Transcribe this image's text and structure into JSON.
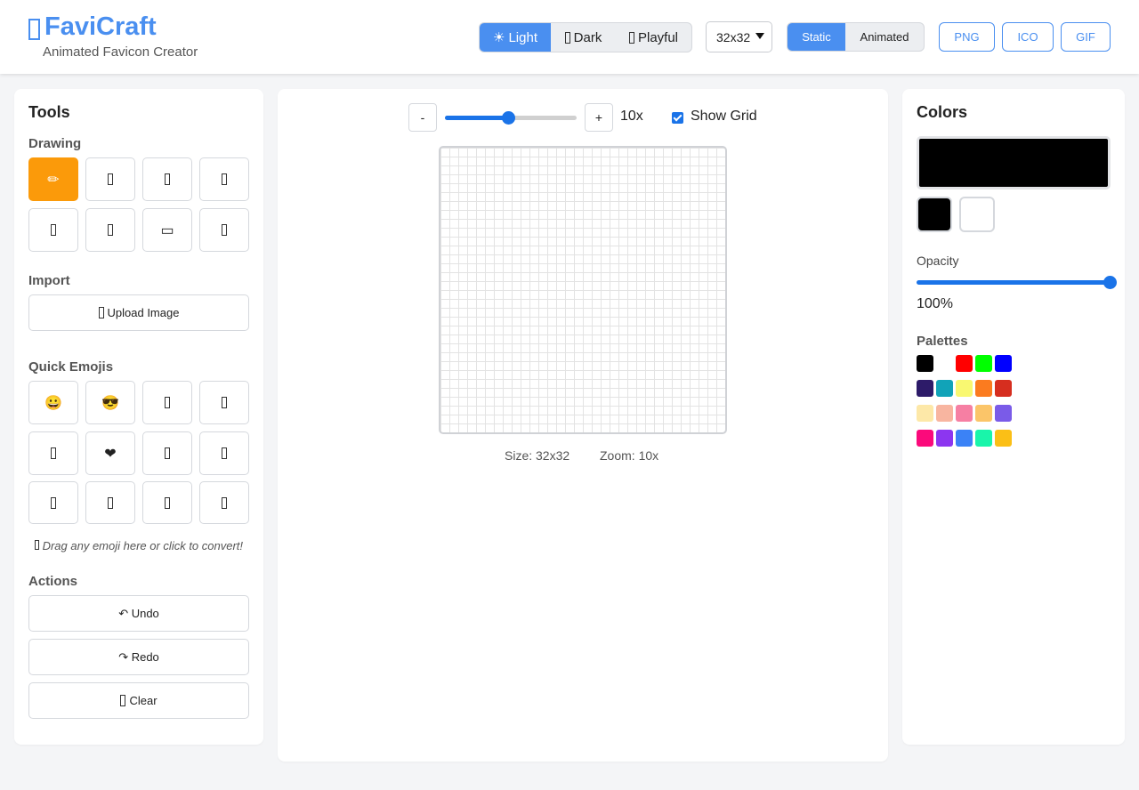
{
  "header": {
    "logo_text": "FaviCraft",
    "subtitle": "Animated Favicon Creator",
    "theme_options": [
      {
        "icon": "☀",
        "label": "Light",
        "active": true
      },
      {
        "icon": "",
        "label": "Dark",
        "active": false
      },
      {
        "icon": "",
        "label": "Playful",
        "active": false
      }
    ],
    "size_select_value": "32x32",
    "mode_options": [
      {
        "label": "Static",
        "active": true
      },
      {
        "label": "Animated",
        "active": false
      }
    ],
    "export_buttons": [
      "PNG",
      "ICO",
      "GIF"
    ]
  },
  "tools": {
    "title": "Tools",
    "drawing_label": "Drawing",
    "drawing_tools": [
      {
        "name": "pencil-tool",
        "glyph": "✏",
        "active": true
      },
      {
        "name": "eraser-tool",
        "glyph": "",
        "active": false
      },
      {
        "name": "fill-tool",
        "glyph": "",
        "active": false
      },
      {
        "name": "eyedropper-tool",
        "glyph": "",
        "active": false
      },
      {
        "name": "line-tool",
        "glyph": "",
        "active": false
      },
      {
        "name": "circle-tool",
        "glyph": "",
        "active": false
      },
      {
        "name": "rectangle-tool",
        "glyph": "▭",
        "active": false
      },
      {
        "name": "move-tool",
        "glyph": "",
        "active": false
      }
    ],
    "import_label": "Import",
    "upload_label": "Upload Image",
    "emojis_label": "Quick Emojis",
    "emojis": [
      "😀",
      "😎",
      "",
      "",
      "",
      "❤",
      "",
      "",
      "",
      "",
      "",
      ""
    ],
    "drag_hint": "Drag any emoji here or click to convert!",
    "actions_label": "Actions",
    "undo_label": "↶ Undo",
    "redo_label": "↷ Redo",
    "clear_label": "Clear"
  },
  "canvas": {
    "zoom_minus": "-",
    "zoom_plus": "+",
    "zoom_value": "10x",
    "zoom_level_fraction": 0.48,
    "show_grid_label": "Show Grid",
    "show_grid_checked": true,
    "size_info": "Size: 32x32",
    "zoom_info": "Zoom: 10x"
  },
  "colors": {
    "title": "Colors",
    "current_color": "#000000",
    "primary_color": "#000000",
    "secondary_color": "#ffffff",
    "opacity_label": "Opacity",
    "opacity_value": "100%",
    "opacity_fraction": 1.0,
    "palettes_label": "Palettes",
    "palettes": [
      [
        "#000000",
        "#ffffff",
        "#ff0000",
        "#00ff00",
        "#0000ff"
      ],
      [
        "#2d1b69",
        "#11a3b8",
        "#f9f871",
        "#fb7b1f",
        "#d62e1f"
      ],
      [
        "#fde8a8",
        "#f8b5a0",
        "#f67fa3",
        "#fbc569",
        "#7a5be8"
      ],
      [
        "#fb0a7b",
        "#8c36f0",
        "#3b82f6",
        "#19f5aa",
        "#fbbf16"
      ]
    ]
  }
}
